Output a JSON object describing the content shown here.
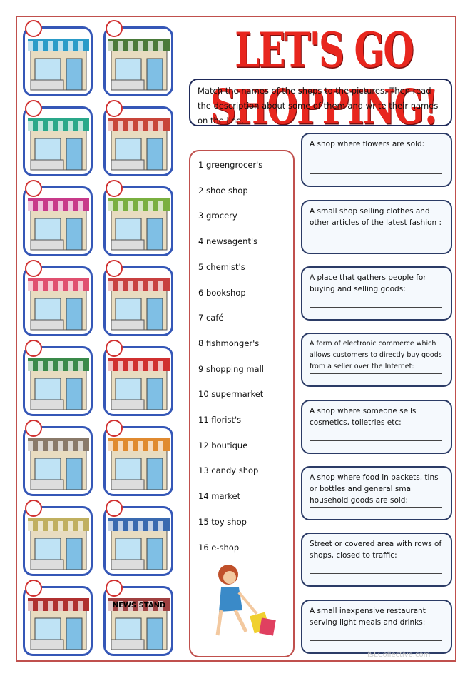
{
  "title": "LET'S GO SHOPPING!",
  "instructions": "Match the names of the shops to the pictures. Then read the description about some of them and write their names on the line.",
  "shops": [
    "1 greengrocer's",
    "2 shoe shop",
    "3 grocery",
    "4 newsagent's",
    "5 chemist's",
    "6 bookshop",
    "7 café",
    "8 fishmonger's",
    "9 shopping mall",
    "10 supermarket",
    "11 florist's",
    "12 boutique",
    "13 candy shop",
    "14 market",
    "15 toy shop",
    "16 e-shop"
  ],
  "descriptions": [
    "A shop where flowers are sold:",
    "A small shop selling clothes and other articles of the latest fashion :",
    "A place that gathers people for buying and selling goods:",
    "A form of electronic commerce which allows customers to directly buy goods from a seller over the Internet:",
    "A shop where someone sells cosmetics, toiletries etc:",
    "A shop where food in packets, tins or bottles and general small household goods are sold:",
    "Street or covered area with rows of shops, closed to traffic:",
    "A small inexpensive restaurant serving light meals and drinks:"
  ],
  "pictures": [
    {
      "icon": "fishmonger-shop-picture",
      "awning": "#2a9bc8"
    },
    {
      "icon": "boutique-shop-picture",
      "awning": "#4a7a3a"
    },
    {
      "icon": "cafe-shop-picture",
      "awning": "#2aa88a"
    },
    {
      "icon": "supermarket-shop-picture",
      "awning": "#c8453a"
    },
    {
      "icon": "shoe-shop-picture",
      "awning": "#c83a8a"
    },
    {
      "icon": "greengrocer-stall-picture",
      "awning": "#7ab040"
    },
    {
      "icon": "toy-shop-picture",
      "awning": "#e05070"
    },
    {
      "icon": "florist-shop-picture",
      "awning": "#c84040"
    },
    {
      "icon": "shopping-mall-picture",
      "awning": "#3a8a4a"
    },
    {
      "icon": "chemist-shop-picture",
      "awning": "#d03030"
    },
    {
      "icon": "e-shop-laptop-picture",
      "awning": "#8a7a6a"
    },
    {
      "icon": "candy-shop-picture",
      "awning": "#e08a30"
    },
    {
      "icon": "market-picture",
      "awning": "#c0b060"
    },
    {
      "icon": "grocery-shop-picture",
      "awning": "#3a6ab0"
    },
    {
      "icon": "bookshop-picture",
      "awning": "#b03030"
    },
    {
      "icon": "news-stand-picture",
      "awning": "#a04040",
      "sign": "NEWS STAND"
    }
  ],
  "watermark": "iSLCollective.com"
}
